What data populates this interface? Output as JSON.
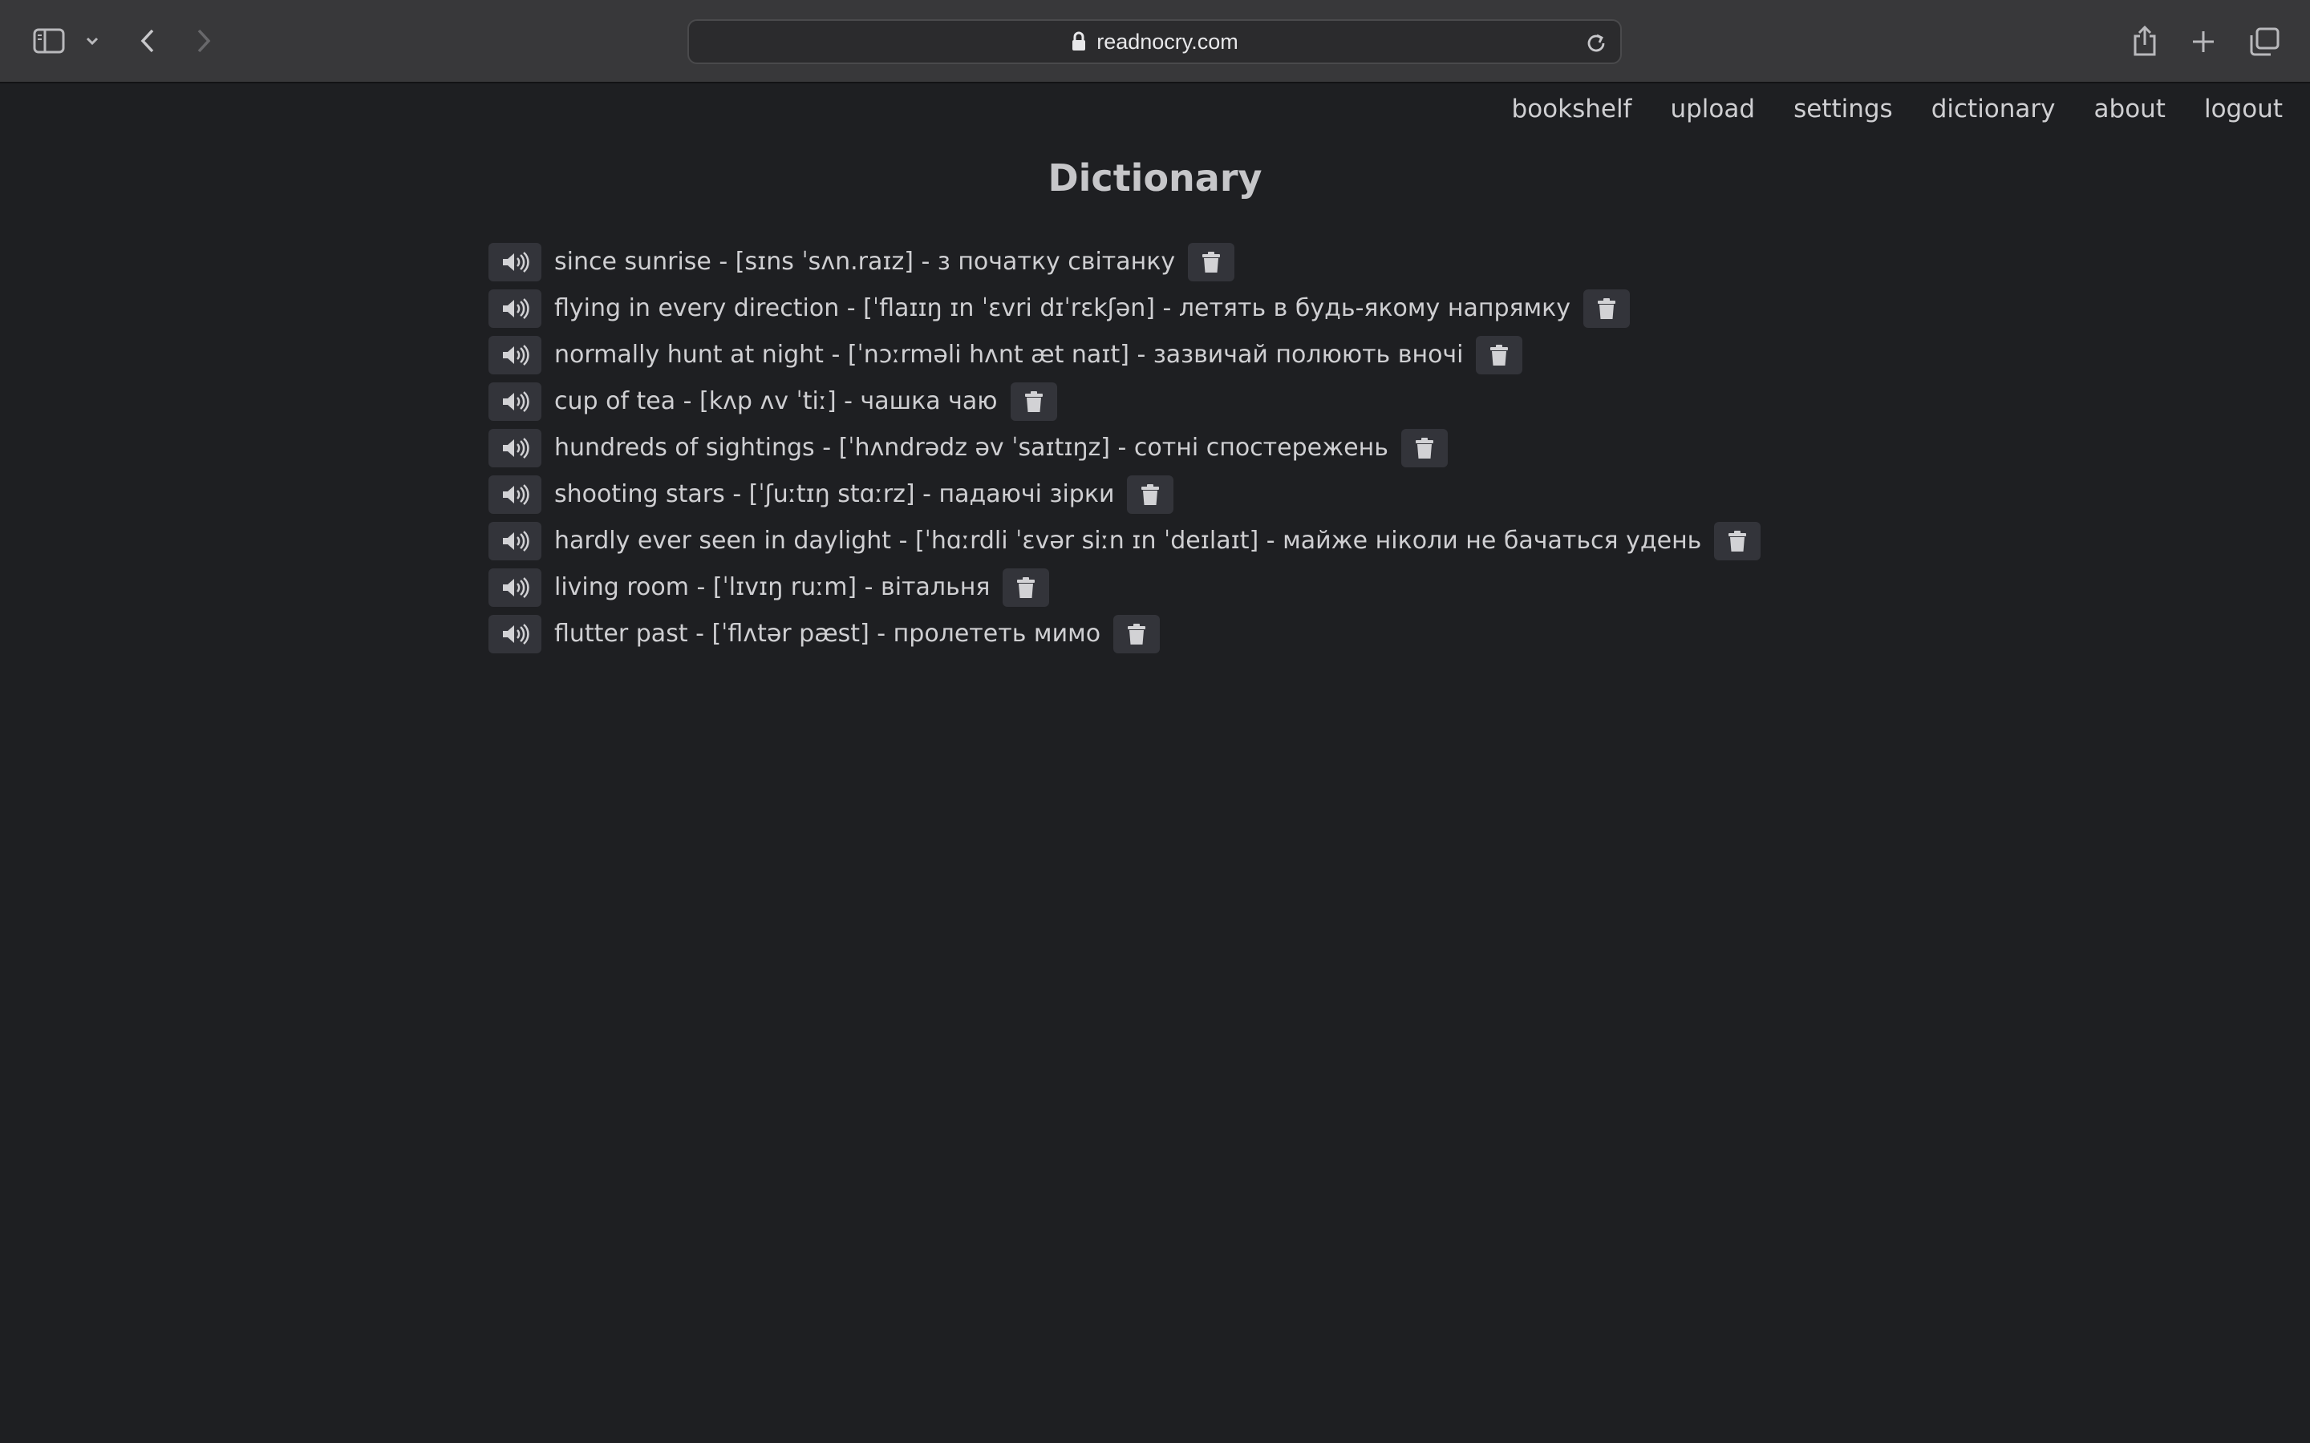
{
  "browser": {
    "url": "readnocry.com",
    "icons": {
      "sidebar": "sidebar-icon",
      "dropdown": "chevron-down-icon",
      "back": "chevron-left-icon",
      "forward": "chevron-right-icon",
      "lock": "lock-icon",
      "reload": "reload-icon",
      "share": "share-icon",
      "new_tab": "plus-icon",
      "tabs": "tabs-overview-icon"
    }
  },
  "nav": {
    "items": [
      "bookshelf",
      "upload",
      "settings",
      "dictionary",
      "about",
      "logout"
    ]
  },
  "page": {
    "title": "Dictionary"
  },
  "dictionary": {
    "entries": [
      "since sunrise - [sɪns ˈsʌn.raɪz] - з початку світанку",
      "flying in every direction - [ˈflaɪɪŋ ɪn ˈɛvri dɪˈrɛkʃən] - летять в будь-якому напрямку",
      "normally hunt at night - [ˈnɔːrməli hʌnt æt naɪt] - зазвичай полюють вночі",
      "cup of tea - [kʌp ʌv ˈtiː] - чашка чаю",
      "hundreds of sightings - [ˈhʌndrədz əv ˈsaɪtɪŋz] - сотні спостережень",
      "shooting stars - [ˈʃuːtɪŋ stɑːrz] - падаючі зірки",
      "hardly ever seen in daylight - [ˈhɑːrdli ˈɛvər siːn ɪn ˈdeɪlaɪt] - майже ніколи не бачаться удень",
      "living room - [ˈlɪvɪŋ ruːm] - вітальня",
      "flutter past - [ˈflʌtər pæst] - пролететь мимо"
    ],
    "icons": {
      "play": "speaker-icon",
      "delete": "trash-icon"
    }
  },
  "colors": {
    "background": "#1e1f22",
    "toolbar": "#38383a",
    "button": "#33343a",
    "text": "#cfcfd2",
    "title": "#c6c6c9"
  }
}
